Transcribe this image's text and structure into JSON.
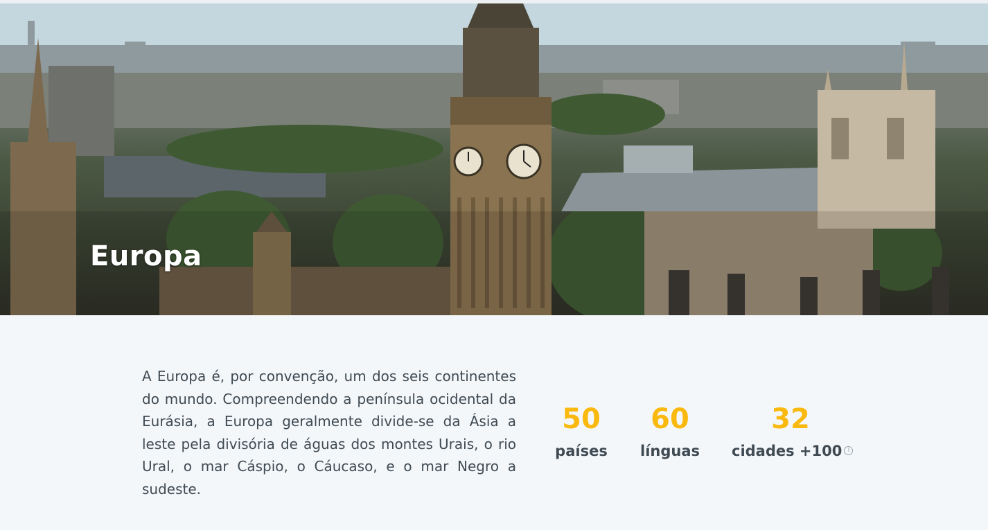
{
  "hero": {
    "title": "Europa",
    "image": "london-westminster-big-ben-cityscape"
  },
  "description": "A Europa é, por convenção, um dos seis continentes do mundo. Compreendendo a península ocidental da Eurásia, a Europa geralmente divide-se da Ásia a leste pela divisória de águas dos montes Urais, o rio Ural, o mar Cáspio, o Cáucaso, e o mar Negro a sudeste.",
  "stats": [
    {
      "value": "50",
      "label": "países"
    },
    {
      "value": "60",
      "label": "línguas"
    },
    {
      "value": "32",
      "label": "cidades +100",
      "info_icon": "info-circle-icon"
    }
  ],
  "colors": {
    "accent": "#f9b90f",
    "text": "#3f4a52",
    "background": "#f4f7fa"
  }
}
